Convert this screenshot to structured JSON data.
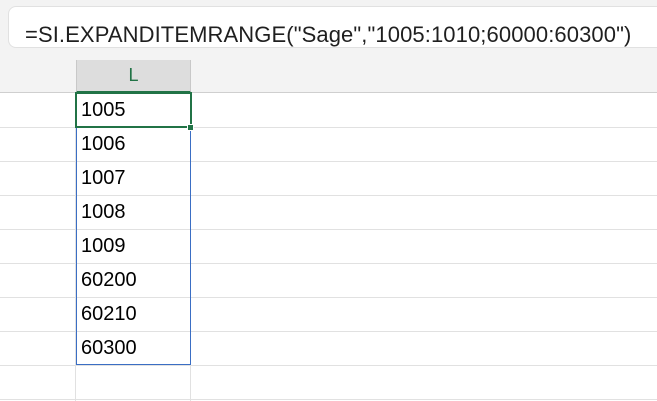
{
  "formula_bar": {
    "formula": "=SI.EXPANDITEMRANGE(\"Sage\",\"1005:1010;60000:60300\")"
  },
  "column_header": {
    "label": "L"
  },
  "cells": [
    {
      "value": "1005"
    },
    {
      "value": "1006"
    },
    {
      "value": "1007"
    },
    {
      "value": "1008"
    },
    {
      "value": "1009"
    },
    {
      "value": "60200"
    },
    {
      "value": "60210"
    },
    {
      "value": "60300"
    }
  ],
  "colors": {
    "selection": "#217346",
    "spill_border": "#3a6ec4",
    "gridline": "#e1e1e1"
  }
}
